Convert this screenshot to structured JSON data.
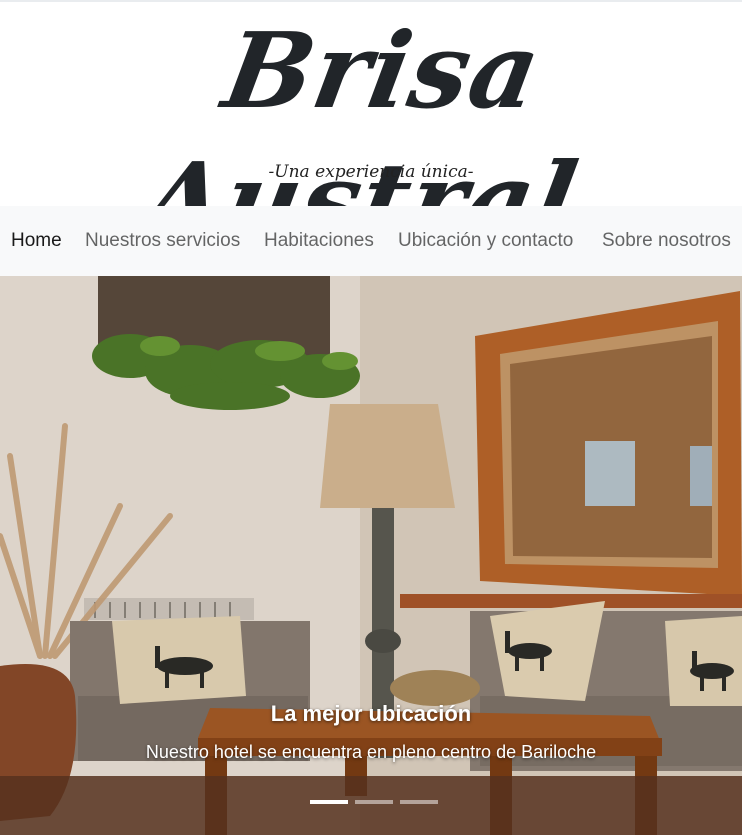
{
  "header": {
    "logo_text": "Brisa Austral",
    "tagline": "-Una experiencia única-"
  },
  "nav": {
    "items": [
      {
        "label": "Home",
        "active": true
      },
      {
        "label": "Nuestros servicios",
        "active": false
      },
      {
        "label": "Habitaciones",
        "active": false
      },
      {
        "label": "Ubicación y contacto",
        "active": false
      },
      {
        "label": "Sobre nosotros",
        "active": false
      }
    ]
  },
  "carousel": {
    "caption_title": "La mejor ubicación",
    "caption_text": "Nuestro hotel se encuentra en pleno centro de Bariloche",
    "slides_count": 3,
    "active_index": 0
  }
}
